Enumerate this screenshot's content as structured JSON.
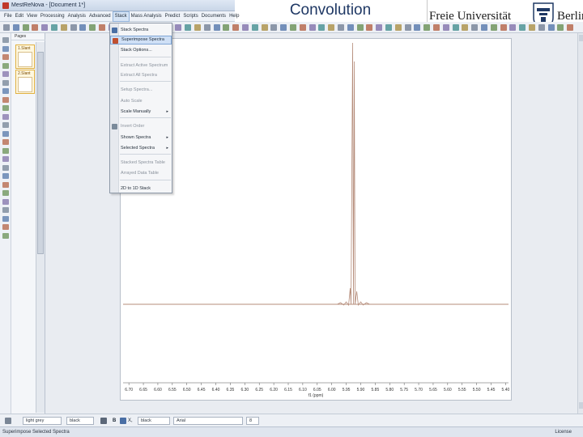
{
  "app": {
    "title": "MestReNova - [Document 1*]",
    "menu": [
      "File",
      "Edit",
      "View",
      "Processing",
      "Analysis",
      "Advanced",
      "Stack",
      "Mass Analysis",
      "Predict",
      "Scripts",
      "Documents",
      "Help"
    ],
    "active_menu": "Stack"
  },
  "slide": {
    "title": "Convolution",
    "logo_text": "Freie Universität",
    "logo_city": "Berlin"
  },
  "pages_panel": {
    "header": "Pages",
    "items": [
      "1.Slant",
      "2.Slant"
    ]
  },
  "stack_menu": {
    "items": [
      {
        "label": "Stack Spectra",
        "disabled": false,
        "submenu": false,
        "highlight": false
      },
      {
        "label": "Superimpose Spectra",
        "disabled": false,
        "submenu": false,
        "highlight": true
      },
      {
        "label": "Stack Options...",
        "disabled": false,
        "submenu": false,
        "highlight": false
      },
      {
        "label": "Extract Active Spectrum",
        "disabled": true,
        "submenu": false,
        "highlight": false
      },
      {
        "label": "Extract All Spectra",
        "disabled": true,
        "submenu": false,
        "highlight": false
      },
      {
        "label": "Setup Spectra...",
        "disabled": true,
        "submenu": false,
        "highlight": false
      },
      {
        "label": "Auto Scale",
        "disabled": true,
        "submenu": false,
        "highlight": false
      },
      {
        "label": "Scale Manually",
        "disabled": false,
        "submenu": true,
        "highlight": false
      },
      {
        "label": "Invert Order",
        "disabled": true,
        "submenu": false,
        "highlight": false
      },
      {
        "label": "Shown Spectra",
        "disabled": false,
        "submenu": true,
        "highlight": false
      },
      {
        "label": "Selected Spectra",
        "disabled": false,
        "submenu": true,
        "highlight": false
      },
      {
        "label": "Stacked Spectra Table",
        "disabled": true,
        "submenu": false,
        "highlight": false
      },
      {
        "label": "Arrayed Data Table",
        "disabled": true,
        "submenu": false,
        "highlight": false
      },
      {
        "label": "2D to 1D Stack",
        "disabled": false,
        "submenu": false,
        "highlight": false
      }
    ]
  },
  "spectrum": {
    "x_ticks": [
      "6.70",
      "6.65",
      "6.60",
      "6.55",
      "6.50",
      "6.45",
      "6.40",
      "6.35",
      "6.30",
      "6.25",
      "6.20",
      "6.15",
      "6.10",
      "6.05",
      "6.00",
      "5.95",
      "5.90",
      "5.85",
      "5.80",
      "5.75",
      "5.70",
      "5.65",
      "5.60",
      "5.55",
      "5.50",
      "5.45",
      "5.40"
    ],
    "x_label": "f1 (ppm)",
    "x_range": [
      6.72,
      5.39
    ],
    "peak_ppm": 5.925,
    "line_color": "#b58c7a"
  },
  "bottom_toolbar": {
    "color_value": "light grey",
    "line_value": "black",
    "font_value": "Arial",
    "size_value": "8"
  },
  "status": {
    "text": "Superimpose Selected Spectra",
    "right": "License"
  }
}
